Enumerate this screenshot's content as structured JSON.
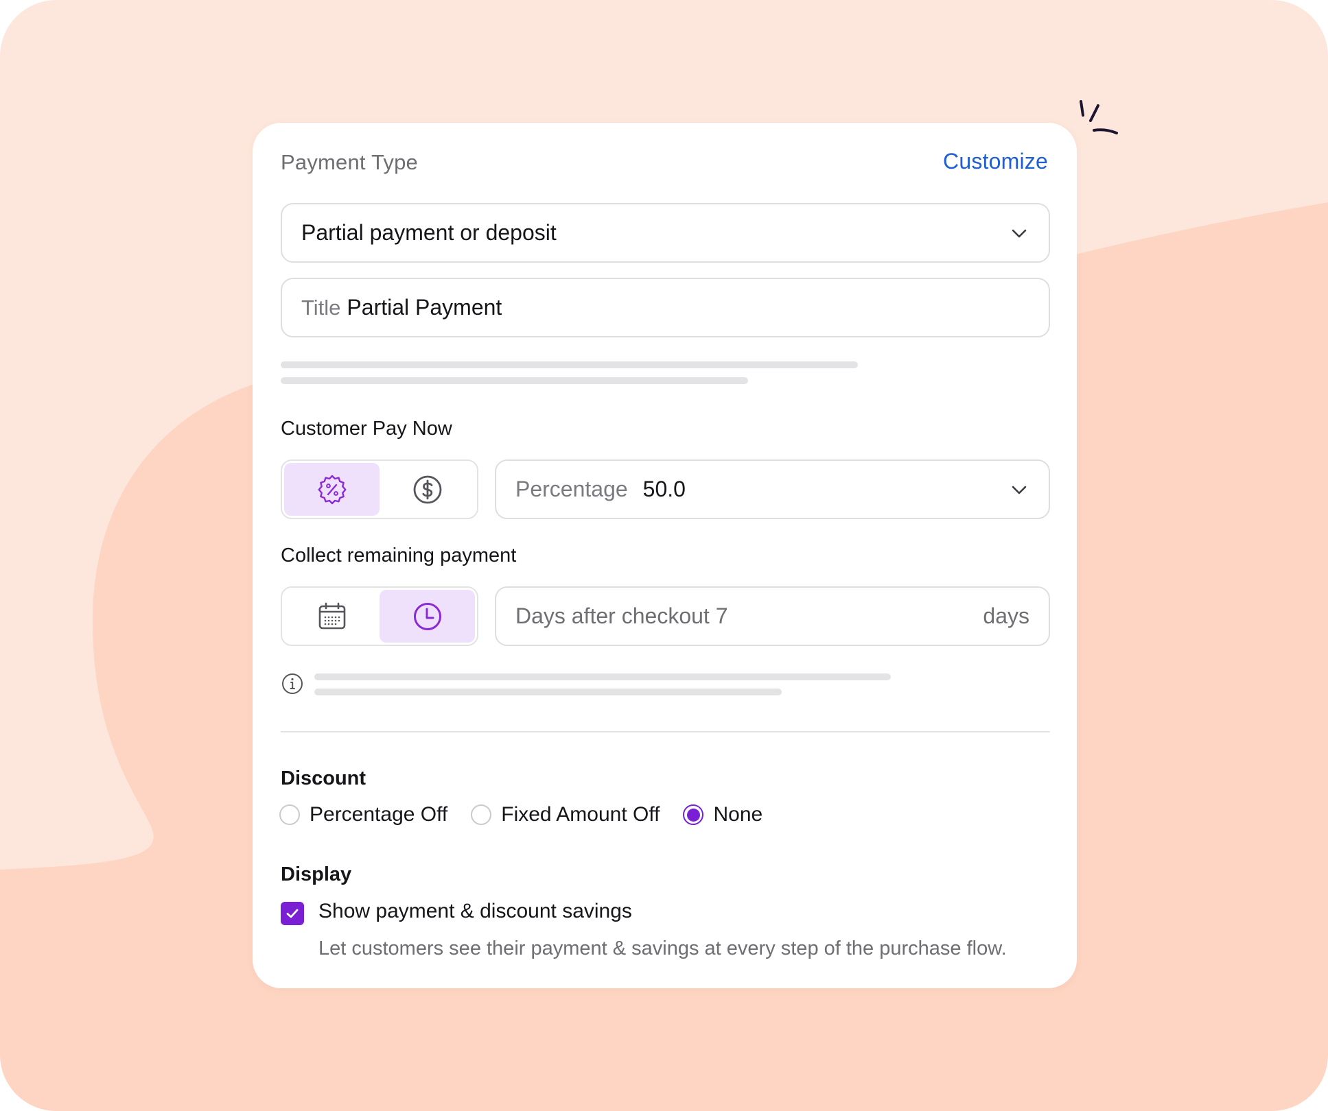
{
  "header": {
    "label": "Payment Type",
    "customize_link": "Customize"
  },
  "payment_type_select": {
    "value": "Partial payment or deposit"
  },
  "title_field": {
    "label": "Title",
    "value": "Partial Payment"
  },
  "pay_now": {
    "title": "Customer Pay Now",
    "toggle": [
      {
        "icon": "percent-badge-icon",
        "selected": true
      },
      {
        "icon": "dollar-circle-icon",
        "selected": false
      }
    ],
    "select_label": "Percentage",
    "select_value": "50.0"
  },
  "remaining": {
    "title": "Collect remaining payment",
    "toggle": [
      {
        "icon": "calendar-icon",
        "selected": false
      },
      {
        "icon": "clock-icon",
        "selected": true
      }
    ],
    "field_label": "Days after checkout 7",
    "field_suffix": "days"
  },
  "discount": {
    "title": "Discount",
    "options": [
      {
        "label": "Percentage Off",
        "selected": false
      },
      {
        "label": "Fixed Amount Off",
        "selected": false
      },
      {
        "label": "None",
        "selected": true
      }
    ]
  },
  "display": {
    "title": "Display",
    "checkbox_checked": true,
    "checkbox_label": "Show payment & discount savings",
    "help_text": "Let customers see their payment & savings at every step of the purchase flow."
  },
  "colors": {
    "accent": "#7b1fd4",
    "accent_light": "#efe1fb",
    "link": "#1f5ed3",
    "background": "#fde6db",
    "background_blob": "#fdd5c2"
  }
}
